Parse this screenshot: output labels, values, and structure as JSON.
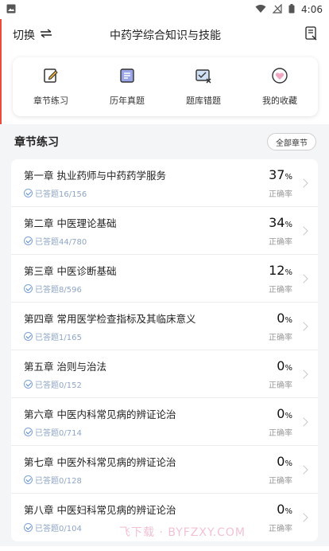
{
  "status_bar": {
    "time": "4:06"
  },
  "header": {
    "switch_label": "切换",
    "title": "中药学综合知识与技能"
  },
  "quick_actions": [
    {
      "label": "章节练习"
    },
    {
      "label": "历年真题"
    },
    {
      "label": "题库错题"
    },
    {
      "label": "我的收藏"
    }
  ],
  "section": {
    "title": "章节练习",
    "all_button": "全部章节"
  },
  "chapters": [
    {
      "title": "第一章 执业药师与中药药学服务",
      "answered": "已答题16/156",
      "percent": "37",
      "unit": "%",
      "acc_label": "正确率"
    },
    {
      "title": "第二章 中医理论基础",
      "answered": "已答题44/780",
      "percent": "34",
      "unit": "%",
      "acc_label": "正确率"
    },
    {
      "title": "第三章 中医诊断基础",
      "answered": "已答题8/596",
      "percent": "12",
      "unit": "%",
      "acc_label": "正确率"
    },
    {
      "title": "第四章 常用医学检查指标及其临床意义",
      "answered": "已答题1/165",
      "percent": "0",
      "unit": "%",
      "acc_label": "正确率"
    },
    {
      "title": "第五章 治则与治法",
      "answered": "已答题0/152",
      "percent": "0",
      "unit": "%",
      "acc_label": "正确率"
    },
    {
      "title": "第六章 中医内科常见病的辨证论治",
      "answered": "已答题0/714",
      "percent": "0",
      "unit": "%",
      "acc_label": "正确率"
    },
    {
      "title": "第七章 中医外科常见病的辨证论治",
      "answered": "已答题0/128",
      "percent": "0",
      "unit": "%",
      "acc_label": "正确率"
    },
    {
      "title": "第八章 中医妇科常见病的辨证论治",
      "answered": "已答题0/104",
      "percent": "0",
      "unit": "%",
      "acc_label": "正确率"
    }
  ],
  "watermark": "飞下载 · BYFZXY.COM",
  "colors": {
    "accent_red": "#e74c3c",
    "check_blue": "#4f87d4",
    "pink": "#f2a7c0"
  }
}
